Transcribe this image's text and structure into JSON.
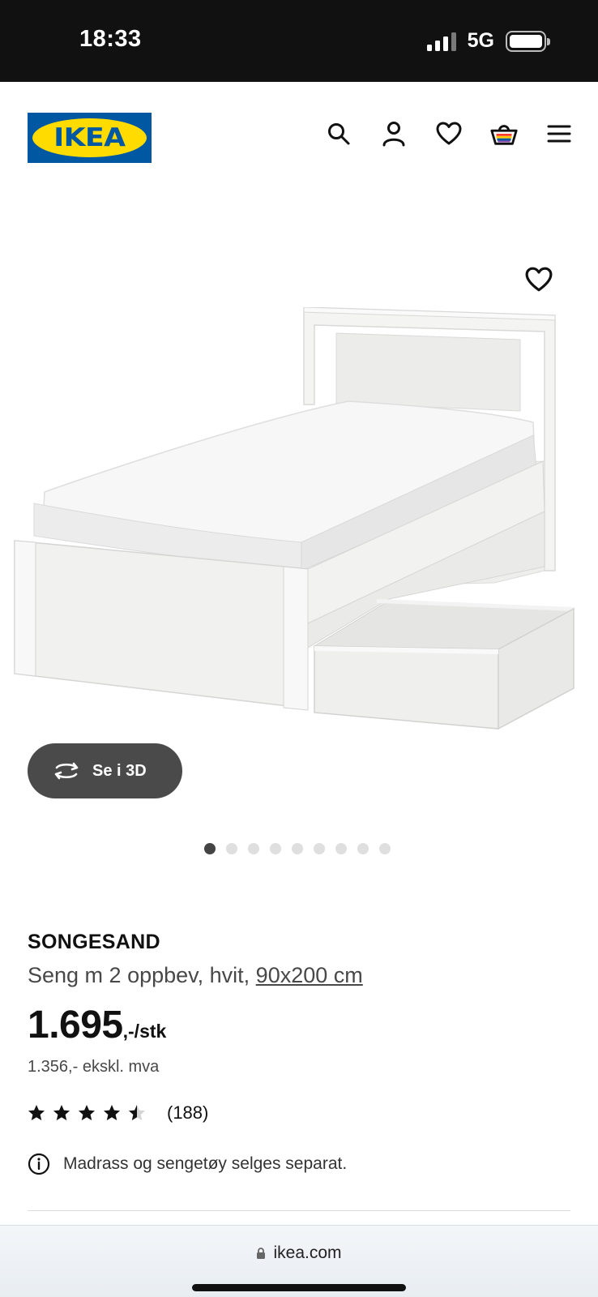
{
  "status_bar": {
    "time": "18:33",
    "network": "5G",
    "icons": [
      "signal-icon",
      "battery-icon"
    ]
  },
  "header": {
    "logo_text": "IKEA",
    "icons": [
      "search-icon",
      "account-icon",
      "heart-icon",
      "basket-icon",
      "menu-icon"
    ],
    "colors": {
      "logo_blue": "#0058a3",
      "logo_yellow": "#ffdb00"
    }
  },
  "gallery": {
    "view3d_label": "Se i 3D",
    "image_count": 9,
    "active_index": 0
  },
  "product": {
    "name": "SONGESAND",
    "description_prefix": "Seng m 2 oppbev, hvit, ",
    "size_link": "90x200 cm",
    "price": "1.695",
    "price_suffix": ",-/stk",
    "price_ex_vat": "1.356,- ekskl. mva",
    "rating_value": 4.5,
    "rating_max": 5,
    "review_count": "(188)",
    "notice": "Madrass og sengetøy selges separat."
  },
  "browser": {
    "url": "ikea.com"
  }
}
